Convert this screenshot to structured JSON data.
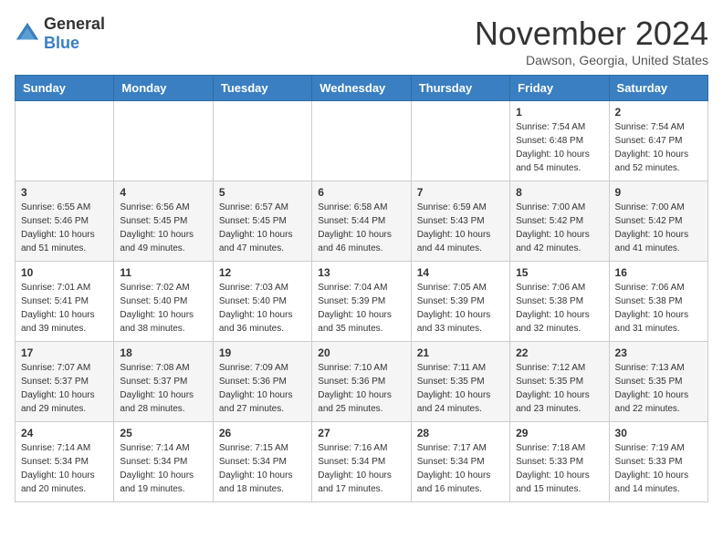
{
  "logo": {
    "general": "General",
    "blue": "Blue"
  },
  "header": {
    "month": "November 2024",
    "location": "Dawson, Georgia, United States"
  },
  "weekdays": [
    "Sunday",
    "Monday",
    "Tuesday",
    "Wednesday",
    "Thursday",
    "Friday",
    "Saturday"
  ],
  "weeks": [
    [
      {
        "day": "",
        "sunrise": "",
        "sunset": "",
        "daylight": ""
      },
      {
        "day": "",
        "sunrise": "",
        "sunset": "",
        "daylight": ""
      },
      {
        "day": "",
        "sunrise": "",
        "sunset": "",
        "daylight": ""
      },
      {
        "day": "",
        "sunrise": "",
        "sunset": "",
        "daylight": ""
      },
      {
        "day": "",
        "sunrise": "",
        "sunset": "",
        "daylight": ""
      },
      {
        "day": "1",
        "sunrise": "Sunrise: 7:54 AM",
        "sunset": "Sunset: 6:48 PM",
        "daylight": "Daylight: 10 hours and 54 minutes."
      },
      {
        "day": "2",
        "sunrise": "Sunrise: 7:54 AM",
        "sunset": "Sunset: 6:47 PM",
        "daylight": "Daylight: 10 hours and 52 minutes."
      }
    ],
    [
      {
        "day": "3",
        "sunrise": "Sunrise: 6:55 AM",
        "sunset": "Sunset: 5:46 PM",
        "daylight": "Daylight: 10 hours and 51 minutes."
      },
      {
        "day": "4",
        "sunrise": "Sunrise: 6:56 AM",
        "sunset": "Sunset: 5:45 PM",
        "daylight": "Daylight: 10 hours and 49 minutes."
      },
      {
        "day": "5",
        "sunrise": "Sunrise: 6:57 AM",
        "sunset": "Sunset: 5:45 PM",
        "daylight": "Daylight: 10 hours and 47 minutes."
      },
      {
        "day": "6",
        "sunrise": "Sunrise: 6:58 AM",
        "sunset": "Sunset: 5:44 PM",
        "daylight": "Daylight: 10 hours and 46 minutes."
      },
      {
        "day": "7",
        "sunrise": "Sunrise: 6:59 AM",
        "sunset": "Sunset: 5:43 PM",
        "daylight": "Daylight: 10 hours and 44 minutes."
      },
      {
        "day": "8",
        "sunrise": "Sunrise: 7:00 AM",
        "sunset": "Sunset: 5:42 PM",
        "daylight": "Daylight: 10 hours and 42 minutes."
      },
      {
        "day": "9",
        "sunrise": "Sunrise: 7:00 AM",
        "sunset": "Sunset: 5:42 PM",
        "daylight": "Daylight: 10 hours and 41 minutes."
      }
    ],
    [
      {
        "day": "10",
        "sunrise": "Sunrise: 7:01 AM",
        "sunset": "Sunset: 5:41 PM",
        "daylight": "Daylight: 10 hours and 39 minutes."
      },
      {
        "day": "11",
        "sunrise": "Sunrise: 7:02 AM",
        "sunset": "Sunset: 5:40 PM",
        "daylight": "Daylight: 10 hours and 38 minutes."
      },
      {
        "day": "12",
        "sunrise": "Sunrise: 7:03 AM",
        "sunset": "Sunset: 5:40 PM",
        "daylight": "Daylight: 10 hours and 36 minutes."
      },
      {
        "day": "13",
        "sunrise": "Sunrise: 7:04 AM",
        "sunset": "Sunset: 5:39 PM",
        "daylight": "Daylight: 10 hours and 35 minutes."
      },
      {
        "day": "14",
        "sunrise": "Sunrise: 7:05 AM",
        "sunset": "Sunset: 5:39 PM",
        "daylight": "Daylight: 10 hours and 33 minutes."
      },
      {
        "day": "15",
        "sunrise": "Sunrise: 7:06 AM",
        "sunset": "Sunset: 5:38 PM",
        "daylight": "Daylight: 10 hours and 32 minutes."
      },
      {
        "day": "16",
        "sunrise": "Sunrise: 7:06 AM",
        "sunset": "Sunset: 5:38 PM",
        "daylight": "Daylight: 10 hours and 31 minutes."
      }
    ],
    [
      {
        "day": "17",
        "sunrise": "Sunrise: 7:07 AM",
        "sunset": "Sunset: 5:37 PM",
        "daylight": "Daylight: 10 hours and 29 minutes."
      },
      {
        "day": "18",
        "sunrise": "Sunrise: 7:08 AM",
        "sunset": "Sunset: 5:37 PM",
        "daylight": "Daylight: 10 hours and 28 minutes."
      },
      {
        "day": "19",
        "sunrise": "Sunrise: 7:09 AM",
        "sunset": "Sunset: 5:36 PM",
        "daylight": "Daylight: 10 hours and 27 minutes."
      },
      {
        "day": "20",
        "sunrise": "Sunrise: 7:10 AM",
        "sunset": "Sunset: 5:36 PM",
        "daylight": "Daylight: 10 hours and 25 minutes."
      },
      {
        "day": "21",
        "sunrise": "Sunrise: 7:11 AM",
        "sunset": "Sunset: 5:35 PM",
        "daylight": "Daylight: 10 hours and 24 minutes."
      },
      {
        "day": "22",
        "sunrise": "Sunrise: 7:12 AM",
        "sunset": "Sunset: 5:35 PM",
        "daylight": "Daylight: 10 hours and 23 minutes."
      },
      {
        "day": "23",
        "sunrise": "Sunrise: 7:13 AM",
        "sunset": "Sunset: 5:35 PM",
        "daylight": "Daylight: 10 hours and 22 minutes."
      }
    ],
    [
      {
        "day": "24",
        "sunrise": "Sunrise: 7:14 AM",
        "sunset": "Sunset: 5:34 PM",
        "daylight": "Daylight: 10 hours and 20 minutes."
      },
      {
        "day": "25",
        "sunrise": "Sunrise: 7:14 AM",
        "sunset": "Sunset: 5:34 PM",
        "daylight": "Daylight: 10 hours and 19 minutes."
      },
      {
        "day": "26",
        "sunrise": "Sunrise: 7:15 AM",
        "sunset": "Sunset: 5:34 PM",
        "daylight": "Daylight: 10 hours and 18 minutes."
      },
      {
        "day": "27",
        "sunrise": "Sunrise: 7:16 AM",
        "sunset": "Sunset: 5:34 PM",
        "daylight": "Daylight: 10 hours and 17 minutes."
      },
      {
        "day": "28",
        "sunrise": "Sunrise: 7:17 AM",
        "sunset": "Sunset: 5:34 PM",
        "daylight": "Daylight: 10 hours and 16 minutes."
      },
      {
        "day": "29",
        "sunrise": "Sunrise: 7:18 AM",
        "sunset": "Sunset: 5:33 PM",
        "daylight": "Daylight: 10 hours and 15 minutes."
      },
      {
        "day": "30",
        "sunrise": "Sunrise: 7:19 AM",
        "sunset": "Sunset: 5:33 PM",
        "daylight": "Daylight: 10 hours and 14 minutes."
      }
    ]
  ]
}
